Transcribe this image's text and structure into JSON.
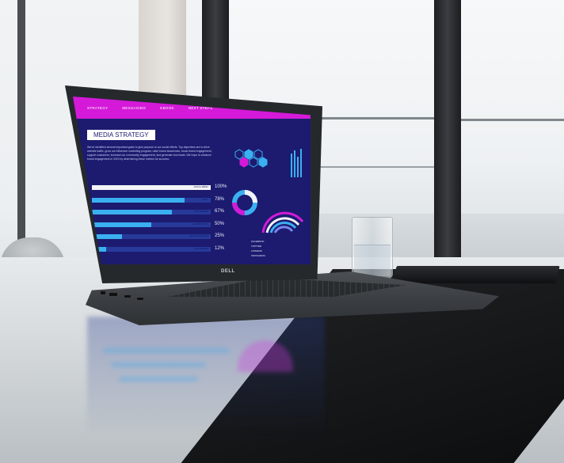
{
  "scene": {
    "subject": "laptop-on-conference-table",
    "brand_logo": "DELL"
  },
  "screen": {
    "menu": [
      "STRATEGY",
      "MESSAGING",
      "EBOOK",
      "NEXT STEPS"
    ],
    "panel_title": "MEDIA STRATEGY",
    "paragraph": "We've identified several important goals to give purpose to our social efforts. Top objectives are to drive website traffic, grow our influencer marketing program, raise brand awareness, boost brand engagement, support customers, increase our community engagement, and generate new leads. We hope to enhance brand engagement in 2019 by determining these metrics for success:",
    "bars": [
      {
        "label": "SOCIAL MEDIA",
        "pct": "100%",
        "fill": 1.0
      },
      {
        "label": "EMAIL",
        "pct": "78%",
        "fill": 0.78
      },
      {
        "label": "PAID SEARCH",
        "pct": "67%",
        "fill": 0.67
      },
      {
        "label": "GUIDED POSTS",
        "pct": "50%",
        "fill": 0.5
      },
      {
        "label": "ORGANIC SEARCH",
        "pct": "25%",
        "fill": 0.25
      },
      {
        "label": "INFLUENCER",
        "pct": "12%",
        "fill": 0.12
      }
    ],
    "legend": [
      "FACEBOOK",
      "TWITTER",
      "LINKEDIN",
      "INSTAGRAM"
    ],
    "colors": {
      "menubar": "#d41ad8",
      "screen_bg": "#1c1b6f",
      "accent_blue": "#3ab0f0",
      "accent_magenta": "#d41ad8"
    }
  }
}
